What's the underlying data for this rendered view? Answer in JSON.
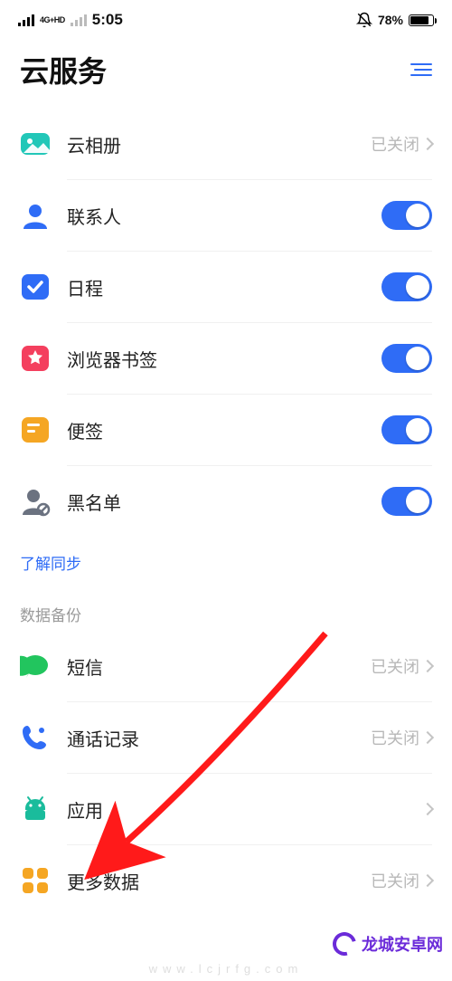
{
  "status_bar": {
    "net_label": "4G+HD",
    "clock": "5:05",
    "battery_pct": "78%"
  },
  "header": {
    "title": "云服务"
  },
  "sync": {
    "photo": {
      "label": "云相册",
      "status": "已关闭"
    },
    "contact": {
      "label": "联系人"
    },
    "calendar": {
      "label": "日程"
    },
    "bookmark": {
      "label": "浏览器书签"
    },
    "note": {
      "label": "便签"
    },
    "blocklist": {
      "label": "黑名单"
    }
  },
  "link": {
    "learn_sync": "了解同步"
  },
  "section": {
    "backup_title": "数据备份"
  },
  "backup": {
    "sms": {
      "label": "短信",
      "status": "已关闭"
    },
    "calllog": {
      "label": "通话记录",
      "status": "已关闭"
    },
    "apps": {
      "label": "应用"
    },
    "more": {
      "label": "更多数据",
      "status": "已关闭"
    }
  },
  "watermark": {
    "url": "www.lcjrfg.com",
    "brand": "龙城安卓网"
  }
}
